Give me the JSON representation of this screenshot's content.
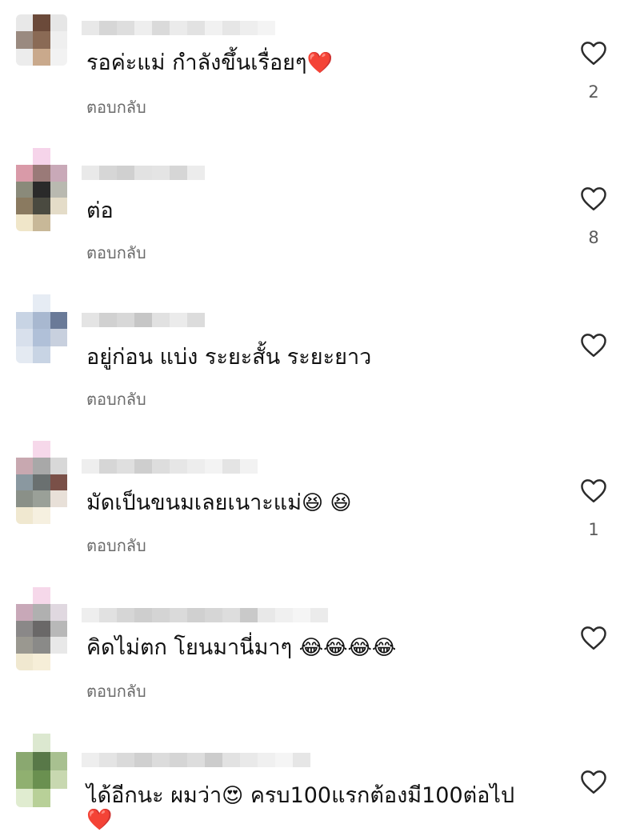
{
  "reply_label": "ตอบกลับ",
  "icons": {
    "like": "heart-outline-icon"
  },
  "colors": {
    "reply_text": "#6b6b6b",
    "count_text": "#5b5b5b",
    "heart_stroke": "#2b2b2b"
  },
  "comments": [
    {
      "text": "รอค่ะแม่ กำลังขึ้นเรื่อยๆ",
      "emoji": "❤️",
      "likes": "2"
    },
    {
      "text": "ต่อ",
      "emoji": "",
      "likes": "8"
    },
    {
      "text": "อยู่ก่อน แบ่ง ระยะสั้น ระยะยาว",
      "emoji": "",
      "likes": ""
    },
    {
      "text": "มัดเป็นขนมเลยเนาะแม่",
      "emoji": "😆 😆",
      "likes": "1"
    },
    {
      "text": "คิดไม่ตก โยนมานี่มาๆ ",
      "emoji": "😂😂😂😂",
      "likes": ""
    },
    {
      "text": "ได้อีกนะ ผมว่า",
      "emoji": "😍",
      "text2": " ครบ100แรกต้องมี100ต่อไป",
      "emoji2": "❤️",
      "likes": ""
    }
  ]
}
